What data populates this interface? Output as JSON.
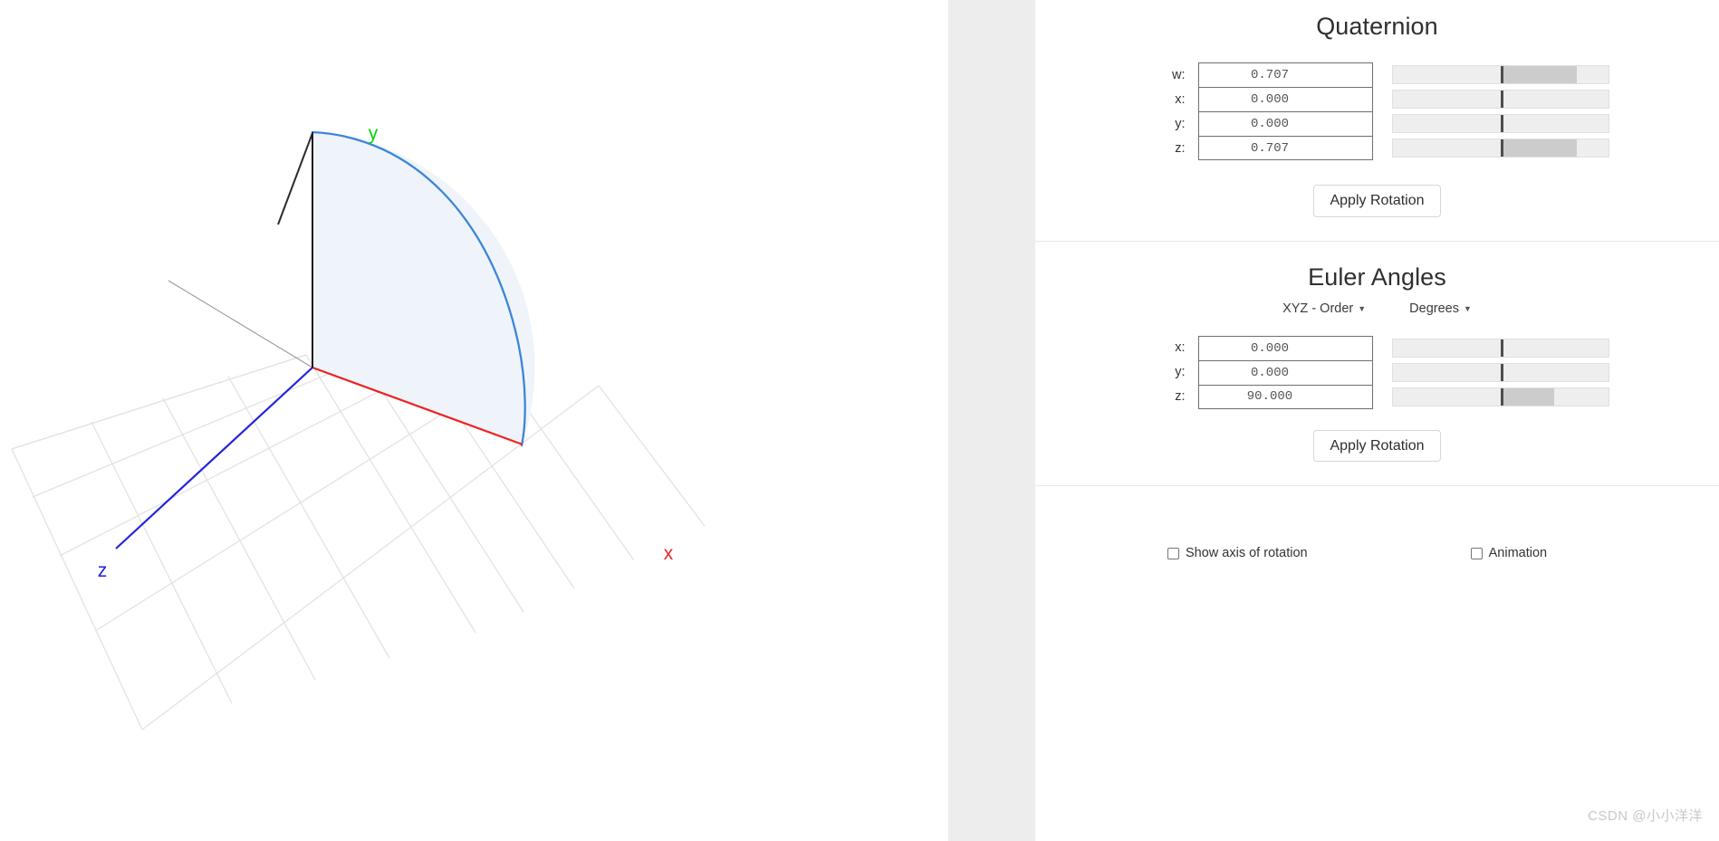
{
  "viewport": {
    "name": "3d-rotation-viewport",
    "axes": [
      {
        "id": "x",
        "label": "x",
        "color": "#ee2222"
      },
      {
        "id": "y",
        "label": "y",
        "color": "#00d900"
      },
      {
        "id": "z",
        "label": "z",
        "color": "#2222dd"
      }
    ],
    "grid_color": "#e3e3e3",
    "grid_center_line_color": "#8a8a8a",
    "arc_stroke_color": "#3d85d8",
    "arc_fill_color": "#eef4f9",
    "rotation_marker_color": "#2b2b2b"
  },
  "quaternion": {
    "title": "Quaternion",
    "fields": [
      {
        "label": "w:",
        "value": "0.707",
        "slider_fill_pct": 35.4
      },
      {
        "label": "x:",
        "value": "0.000",
        "slider_fill_pct": 0
      },
      {
        "label": "y:",
        "value": "0.000",
        "slider_fill_pct": 0
      },
      {
        "label": "z:",
        "value": "0.707",
        "slider_fill_pct": 35.4
      }
    ],
    "apply_label": "Apply Rotation"
  },
  "euler": {
    "title": "Euler Angles",
    "order_label": "XYZ - Order",
    "unit_label": "Degrees",
    "fields": [
      {
        "label": "x:",
        "value": "0.000",
        "slider_fill_pct": 0
      },
      {
        "label": "y:",
        "value": "0.000",
        "slider_fill_pct": 0
      },
      {
        "label": "z:",
        "value": "90.000",
        "slider_fill_pct": 25
      }
    ],
    "apply_label": "Apply Rotation"
  },
  "options": {
    "show_axis": {
      "label": "Show axis of rotation",
      "checked": false
    },
    "animation": {
      "label": "Animation",
      "checked": false
    }
  },
  "watermark": {
    "text": "CSDN @小小洋洋"
  }
}
